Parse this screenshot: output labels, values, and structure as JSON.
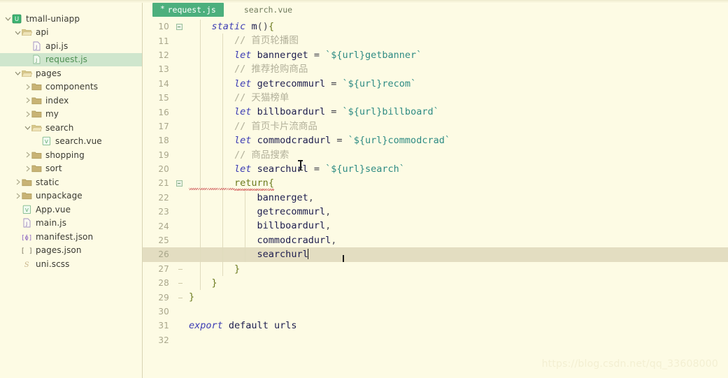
{
  "sidebar": {
    "name": "project-explorer",
    "tree": [
      {
        "label": "tmall-uniapp",
        "indent": 0,
        "twisty": "expanded",
        "icon": "uniapp-project-icon",
        "selected": false
      },
      {
        "label": "api",
        "indent": 1,
        "twisty": "expanded",
        "icon": "folder-open-icon",
        "selected": false
      },
      {
        "label": "api.js",
        "indent": 2,
        "twisty": "none",
        "icon": "js-file-icon",
        "selected": false
      },
      {
        "label": "request.js",
        "indent": 2,
        "twisty": "none",
        "icon": "js-file-icon",
        "selected": true
      },
      {
        "label": "pages",
        "indent": 1,
        "twisty": "expanded",
        "icon": "folder-open-icon",
        "selected": false
      },
      {
        "label": "components",
        "indent": 2,
        "twisty": "collapsed",
        "icon": "folder-closed-icon",
        "selected": false
      },
      {
        "label": "index",
        "indent": 2,
        "twisty": "collapsed",
        "icon": "folder-closed-icon",
        "selected": false
      },
      {
        "label": "my",
        "indent": 2,
        "twisty": "collapsed",
        "icon": "folder-closed-icon",
        "selected": false
      },
      {
        "label": "search",
        "indent": 2,
        "twisty": "expanded",
        "icon": "folder-open-icon",
        "selected": false
      },
      {
        "label": "search.vue",
        "indent": 3,
        "twisty": "none",
        "icon": "vue-file-icon",
        "selected": false
      },
      {
        "label": "shopping",
        "indent": 2,
        "twisty": "collapsed",
        "icon": "folder-closed-icon",
        "selected": false
      },
      {
        "label": "sort",
        "indent": 2,
        "twisty": "collapsed",
        "icon": "folder-closed-icon",
        "selected": false
      },
      {
        "label": "static",
        "indent": 1,
        "twisty": "collapsed",
        "icon": "folder-closed-icon",
        "selected": false
      },
      {
        "label": "unpackage",
        "indent": 1,
        "twisty": "collapsed",
        "icon": "folder-closed-icon",
        "selected": false
      },
      {
        "label": "App.vue",
        "indent": 1,
        "twisty": "none",
        "icon": "vue-file-icon",
        "selected": false
      },
      {
        "label": "main.js",
        "indent": 1,
        "twisty": "none",
        "icon": "js-file-icon",
        "selected": false
      },
      {
        "label": "manifest.json",
        "indent": 1,
        "twisty": "none",
        "icon": "json-manifest-icon",
        "selected": false
      },
      {
        "label": "pages.json",
        "indent": 1,
        "twisty": "none",
        "icon": "json-array-icon",
        "selected": false
      },
      {
        "label": "uni.scss",
        "indent": 1,
        "twisty": "none",
        "icon": "scss-file-icon",
        "selected": false
      }
    ]
  },
  "tabs": [
    {
      "label": "request.js",
      "modified_marker": "*",
      "active": true
    },
    {
      "label": "search.vue",
      "modified_marker": "",
      "active": false
    }
  ],
  "editor": {
    "first_line_number": 10,
    "current_line": 26,
    "lines": [
      {
        "num": "10",
        "text": "    static m(){"
      },
      {
        "num": "11",
        "text": "        // 首页轮播图"
      },
      {
        "num": "12",
        "text": "        let bannerget = `${url}getbanner`"
      },
      {
        "num": "13",
        "text": "        // 推荐抢购商品"
      },
      {
        "num": "14",
        "text": "        let getrecommurl = `${url}recom`"
      },
      {
        "num": "15",
        "text": "        // 天猫榜单"
      },
      {
        "num": "16",
        "text": "        let billboardurl = `${url}billboard`"
      },
      {
        "num": "17",
        "text": "        // 首页卡片流商品"
      },
      {
        "num": "18",
        "text": "        let commodcradurl = `${url}commodcrad`"
      },
      {
        "num": "19",
        "text": "        // 商品搜索"
      },
      {
        "num": "20",
        "text": "        let searchurl = `${url}search`"
      },
      {
        "num": "21",
        "text": "        return{"
      },
      {
        "num": "22",
        "text": "            bannerget,"
      },
      {
        "num": "23",
        "text": "            getrecommurl,"
      },
      {
        "num": "24",
        "text": "            billboardurl,"
      },
      {
        "num": "25",
        "text": "            commodcradurl,"
      },
      {
        "num": "26",
        "text": "            searchurl"
      },
      {
        "num": "27",
        "text": "        }"
      },
      {
        "num": "28",
        "text": "    }"
      },
      {
        "num": "29",
        "text": "}"
      },
      {
        "num": "30",
        "text": ""
      },
      {
        "num": "31",
        "text": "export default urls"
      },
      {
        "num": "32",
        "text": ""
      }
    ],
    "tokens": {
      "kw_static": "static",
      "kw_let": "let",
      "kw_export": "export",
      "kw_default": "default",
      "fn_m": "m",
      "kw_return": "return",
      "ident_urls": "urls",
      "v_bannerget": "bannerget",
      "v_getrecommurl": "getrecommurl",
      "v_billboardurl": "billboardurl",
      "v_commodcradurl": "commodcradurl",
      "v_searchurl": "searchurl",
      "t_getbanner": "`${url}getbanner`",
      "t_recom": "`${url}recom`",
      "t_billboard": "`${url}billboard`",
      "t_commodcrad": "`${url}commodcrad`",
      "t_search": "`${url}search`",
      "c_banner": "// 首页轮播图",
      "c_recom": "// 推荐抢购商品",
      "c_billboard": "// 天猫榜单",
      "c_card": "// 首页卡片流商品",
      "c_search": "// 商品搜索",
      "eq": "=",
      "comma": ",",
      "paren": "()",
      "brace_open": "{",
      "brace_close": "}"
    },
    "line_numbers": {
      "n10": "10",
      "n11": "11",
      "n12": "12",
      "n13": "13",
      "n14": "14",
      "n15": "15",
      "n16": "16",
      "n17": "17",
      "n18": "18",
      "n19": "19",
      "n20": "20",
      "n21": "21",
      "n22": "22",
      "n23": "23",
      "n24": "24",
      "n25": "25",
      "n26": "26",
      "n27": "27",
      "n28": "28",
      "n29": "29",
      "n30": "30",
      "n31": "31",
      "n32": "32"
    }
  },
  "watermark": {
    "text": "https://blog.csdn.net/qq_33608000"
  },
  "colors": {
    "background": "#fdfbe4",
    "selection_green": "#cfe6cd",
    "active_tab_green": "#4caf7d",
    "current_line": "#e3ddc1",
    "keyword_blue": "#3c3cb4",
    "template_teal": "#2e8b83",
    "comment_gray": "#b2b09a",
    "brace_olive": "#6b7a1e",
    "gutter_text": "#a9a68b",
    "error_red": "#cf5a5a"
  }
}
